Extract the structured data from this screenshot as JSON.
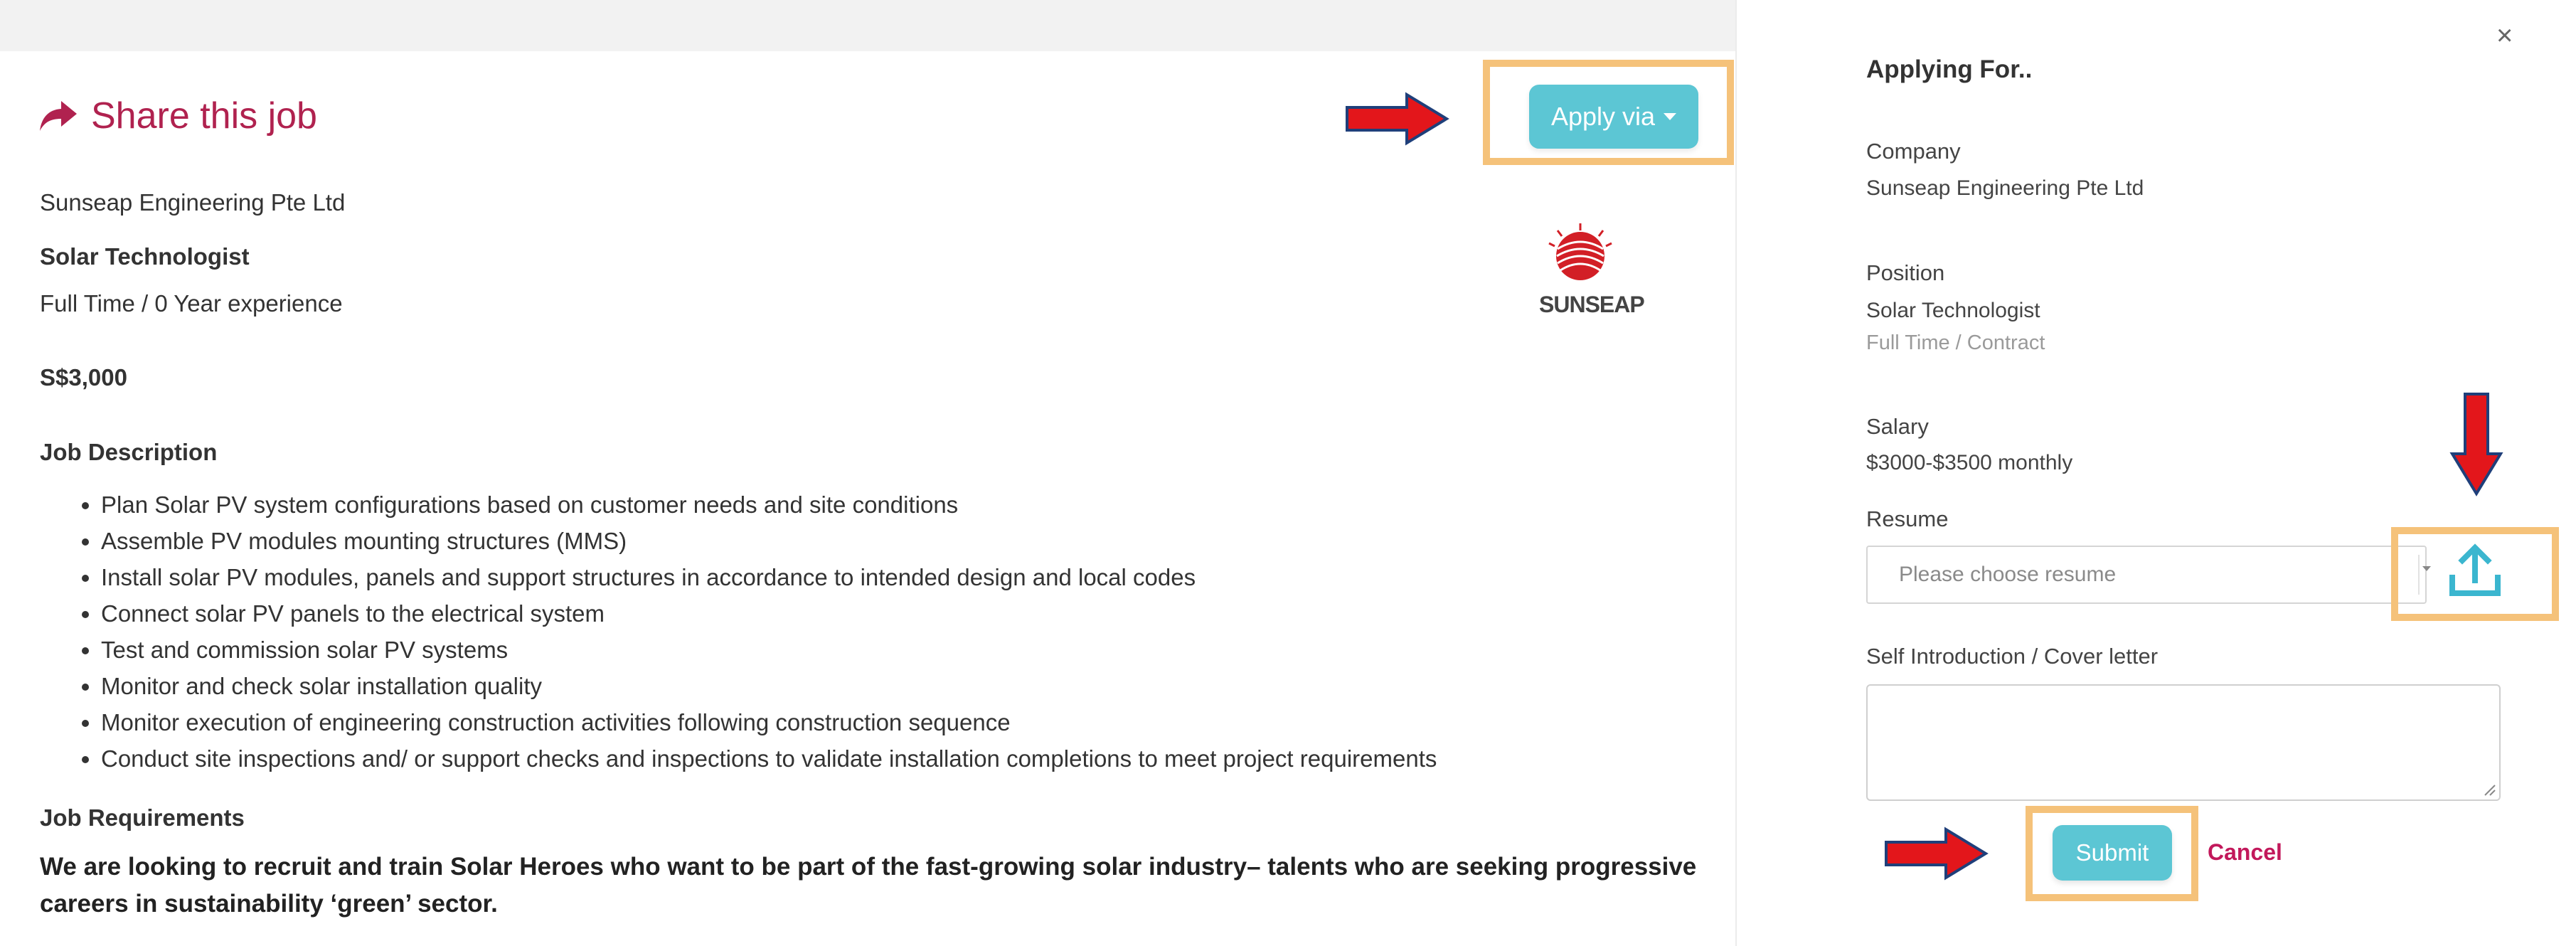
{
  "job": {
    "share_label": "Share this job",
    "apply_label": "Apply via",
    "company": "Sunseap Engineering Pte Ltd",
    "position": "Solar Technologist",
    "employment": "Full Time  / 0 Year experience",
    "salary": "S$3,000",
    "logo_text": "SUNSEAP",
    "description_heading": "Job Description",
    "description_items": [
      "Plan Solar PV system configurations based on customer needs and site conditions",
      "Assemble PV modules mounting structures (MMS)",
      "Install solar PV modules, panels and support structures in accordance to intended design and local codes",
      "Connect solar PV panels to the electrical system",
      "Test and commission solar PV systems",
      "Monitor and check solar installation quality",
      "Monitor execution of engineering construction activities following construction sequence",
      "Conduct site inspections and/ or support checks and inspections to validate installation completions to meet project requirements"
    ],
    "requirements_heading": "Job Requirements",
    "requirements_text": "We are looking to recruit and train Solar Heroes who want to be part of the fast-growing solar industry– talents who are seeking progressive careers in sustainability ‘green’ sector."
  },
  "application": {
    "close_symbol": "×",
    "heading": "Applying For..",
    "company_label": "Company",
    "company_value": "Sunseap Engineering Pte Ltd",
    "position_label": "Position",
    "position_value": "Solar Technologist",
    "position_type": "Full Time / Contract",
    "salary_label": "Salary",
    "salary_value": "$3000-$3500 monthly",
    "resume_label": "Resume",
    "resume_placeholder": "Please choose resume",
    "cover_label": "Self Introduction / Cover letter",
    "submit_label": "Submit",
    "cancel_label": "Cancel"
  },
  "colors": {
    "accent_button": "#5cc6d4",
    "share_text": "#b0224f",
    "cancel_text": "#c2185b",
    "highlight_box": "#f5c27a",
    "arrow_red": "#e3161b",
    "upload_icon": "#3bb6cf"
  },
  "icons": {
    "share": "share-arrow-icon",
    "caret": "caret-down-icon",
    "close": "close-icon",
    "upload": "upload-icon",
    "pointer": "red-arrow-icon"
  }
}
